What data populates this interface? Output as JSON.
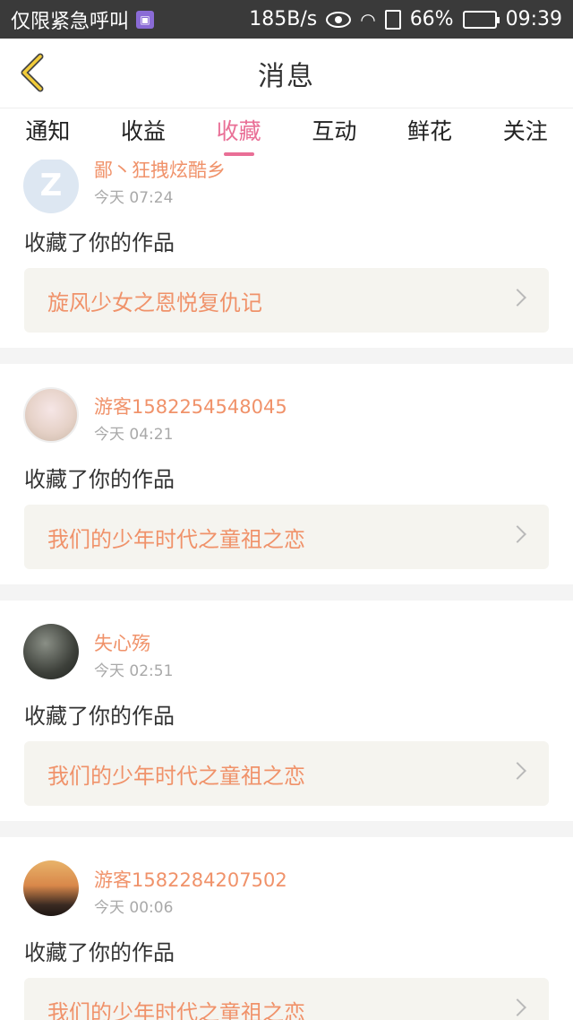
{
  "status_bar": {
    "carrier": "仅限紧急呼叫",
    "speed": "185B/s",
    "battery": "66%",
    "battery_level": 0.66,
    "time": "09:39"
  },
  "header": {
    "title": "消息",
    "back_icon": "chevron-left-icon"
  },
  "tabs": [
    {
      "label": "通知"
    },
    {
      "label": "收益"
    },
    {
      "label": "收藏",
      "active": true
    },
    {
      "label": "互动"
    },
    {
      "label": "鲜花"
    },
    {
      "label": "关注"
    }
  ],
  "messages": [
    {
      "username": "鄙丶狂拽炫酷乡",
      "time": "今天 07:24",
      "action": "收藏了你的作品",
      "work": "旋风少女之恩悦复仇记"
    },
    {
      "username": "游客1582254548045",
      "time": "今天 04:21",
      "action": "收藏了你的作品",
      "work": "我们的少年时代之童祖之恋"
    },
    {
      "username": "失心殇",
      "time": "今天 02:51",
      "action": "收藏了你的作品",
      "work": "我们的少年时代之童祖之恋"
    },
    {
      "username": "游客1582284207502",
      "time": "今天 00:06",
      "action": "收藏了你的作品",
      "work": "我们的少年时代之童祖之恋"
    }
  ],
  "colors": {
    "accent": "#e96f96",
    "username": "#f0926a",
    "status_bar": "#3a3a3a",
    "work_box": "#f5f4ef"
  }
}
